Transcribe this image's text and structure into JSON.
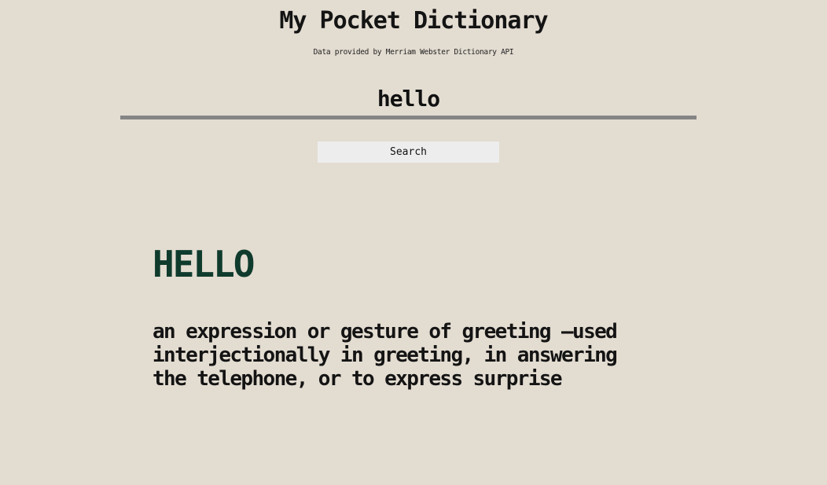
{
  "header": {
    "title": "My Pocket Dictionary",
    "attribution": "Data provided by Merriam Webster Dictionary API"
  },
  "search": {
    "value": "hello",
    "button_label": "Search"
  },
  "result": {
    "word": "HELLO",
    "definition": "an expression or gesture of greeting —used interjectionally in greeting, in answering the telephone, or to express surprise"
  },
  "colors": {
    "background": "#e3dcd1",
    "word": "#0f3b2d",
    "underline": "#858585",
    "button": "#ededed"
  }
}
